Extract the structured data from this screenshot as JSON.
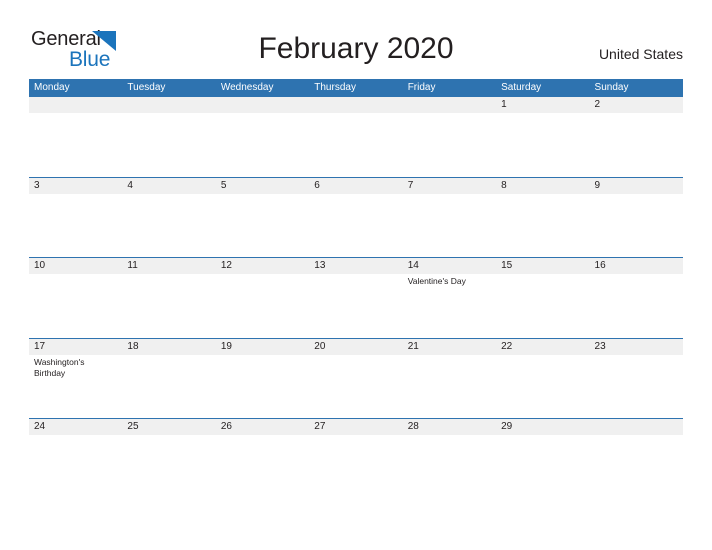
{
  "brand": {
    "name_part1": "General",
    "name_part2": "Blue",
    "flag_icon": "blue-triangle-flag-icon",
    "accent_color": "#1b74bc"
  },
  "header": {
    "title": "February 2020",
    "locale": "United States"
  },
  "colors": {
    "header_blue": "#2e73b0",
    "band_gray": "#f0f0f0",
    "text": "#231f20",
    "logo_blue": "#1b74bc"
  },
  "calendar": {
    "month": "February",
    "year": "2020",
    "weekdays": [
      "Monday",
      "Tuesday",
      "Wednesday",
      "Thursday",
      "Friday",
      "Saturday",
      "Sunday"
    ],
    "weeks": [
      [
        {
          "day": "",
          "event": ""
        },
        {
          "day": "",
          "event": ""
        },
        {
          "day": "",
          "event": ""
        },
        {
          "day": "",
          "event": ""
        },
        {
          "day": "",
          "event": ""
        },
        {
          "day": "1",
          "event": ""
        },
        {
          "day": "2",
          "event": ""
        }
      ],
      [
        {
          "day": "3",
          "event": ""
        },
        {
          "day": "4",
          "event": ""
        },
        {
          "day": "5",
          "event": ""
        },
        {
          "day": "6",
          "event": ""
        },
        {
          "day": "7",
          "event": ""
        },
        {
          "day": "8",
          "event": ""
        },
        {
          "day": "9",
          "event": ""
        }
      ],
      [
        {
          "day": "10",
          "event": ""
        },
        {
          "day": "11",
          "event": ""
        },
        {
          "day": "12",
          "event": ""
        },
        {
          "day": "13",
          "event": ""
        },
        {
          "day": "14",
          "event": "Valentine's Day"
        },
        {
          "day": "15",
          "event": ""
        },
        {
          "day": "16",
          "event": ""
        }
      ],
      [
        {
          "day": "17",
          "event": "Washington's Birthday"
        },
        {
          "day": "18",
          "event": ""
        },
        {
          "day": "19",
          "event": ""
        },
        {
          "day": "20",
          "event": ""
        },
        {
          "day": "21",
          "event": ""
        },
        {
          "day": "22",
          "event": ""
        },
        {
          "day": "23",
          "event": ""
        }
      ],
      [
        {
          "day": "24",
          "event": ""
        },
        {
          "day": "25",
          "event": ""
        },
        {
          "day": "26",
          "event": ""
        },
        {
          "day": "27",
          "event": ""
        },
        {
          "day": "28",
          "event": ""
        },
        {
          "day": "29",
          "event": ""
        },
        {
          "day": "",
          "event": ""
        }
      ]
    ]
  }
}
